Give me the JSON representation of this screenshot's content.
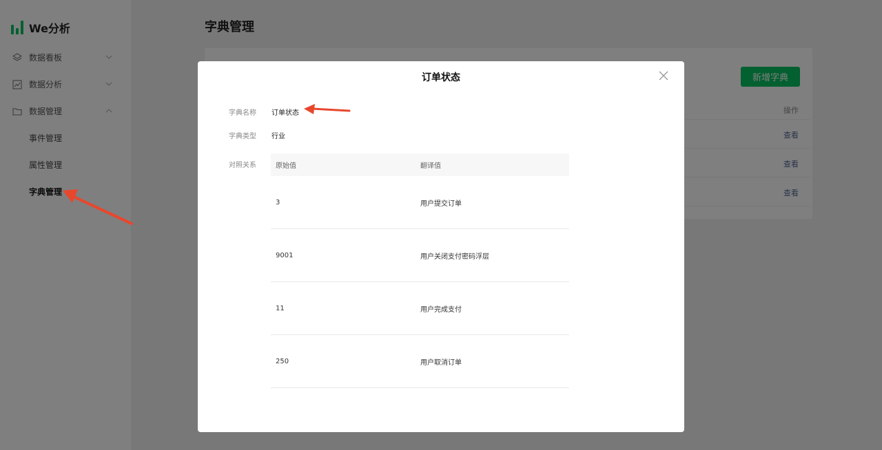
{
  "app": {
    "name": "We分析"
  },
  "sidebar": {
    "menus": [
      {
        "label": "数据看板",
        "icon": "layers-icon",
        "expanded": false
      },
      {
        "label": "数据分析",
        "icon": "line-chart-icon",
        "expanded": false
      },
      {
        "label": "数据管理",
        "icon": "folder-icon",
        "expanded": true
      }
    ],
    "sub_items": [
      {
        "label": "事件管理",
        "active": false
      },
      {
        "label": "属性管理",
        "active": false
      },
      {
        "label": "字典管理",
        "active": true
      }
    ]
  },
  "main": {
    "title": "字典管理",
    "new_button": "新增字典",
    "column_action": "操作",
    "row_actions": [
      "查看",
      "查看",
      "查看"
    ]
  },
  "modal": {
    "title": "订单状态",
    "fields": {
      "name_label": "字典名称",
      "name_value": "订单状态",
      "type_label": "字典类型",
      "type_value": "行业",
      "mapping_label": "对照关系"
    },
    "table": {
      "headers": [
        "原始值",
        "翻译值"
      ],
      "rows": [
        [
          "3",
          "用户提交订单"
        ],
        [
          "9001",
          "用户关闭支付密码浮层"
        ],
        [
          "11",
          "用户完成支付"
        ],
        [
          "250",
          "用户取消订单"
        ]
      ]
    }
  },
  "colors": {
    "brand": "#07c160",
    "annotation_arrow": "#e8472d",
    "link": "#576b95"
  }
}
